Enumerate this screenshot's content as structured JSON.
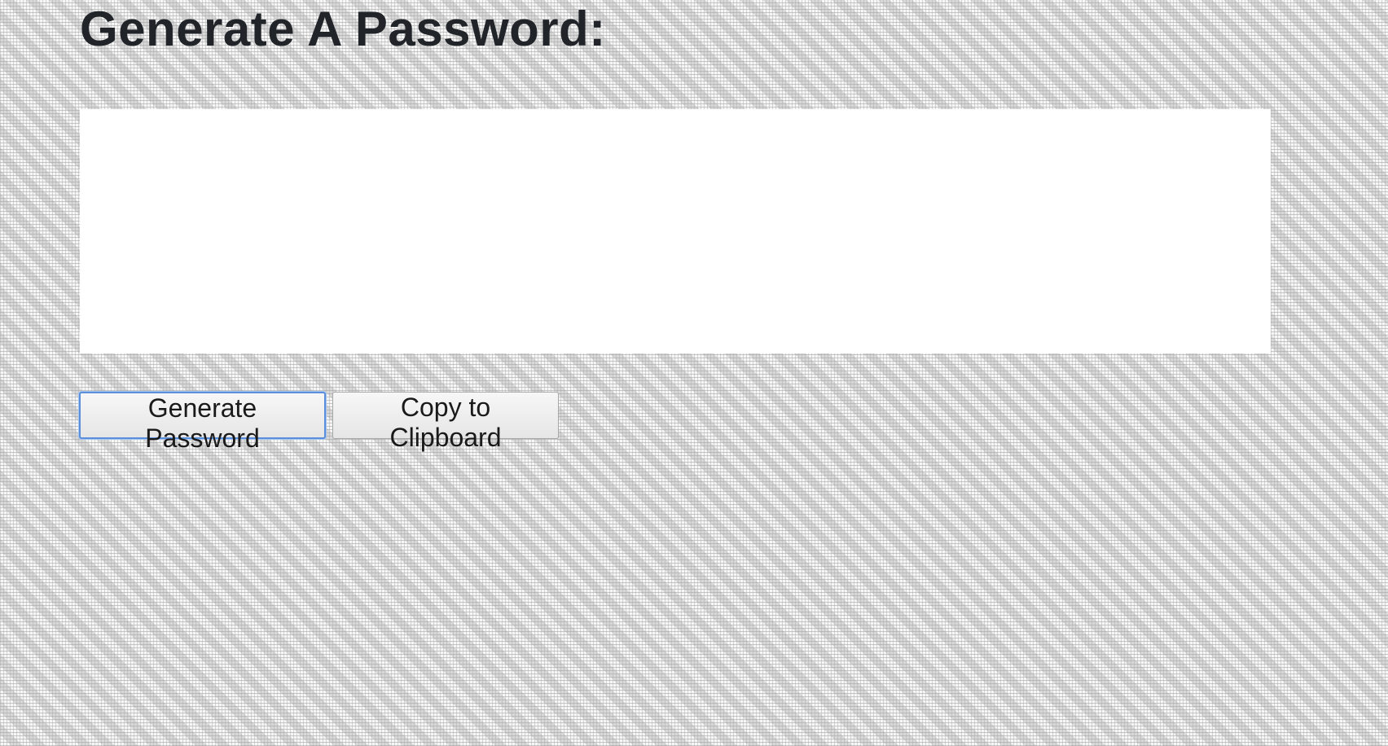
{
  "header": {
    "title": "Generate A Password:"
  },
  "password_box": {
    "value": "",
    "placeholder": ""
  },
  "actions": {
    "generate_label": "Generate Password",
    "copy_label": "Copy to Clipboard"
  },
  "colors": {
    "background": "#ececec",
    "text": "#212529",
    "focus_ring": "#5b8fdc"
  }
}
